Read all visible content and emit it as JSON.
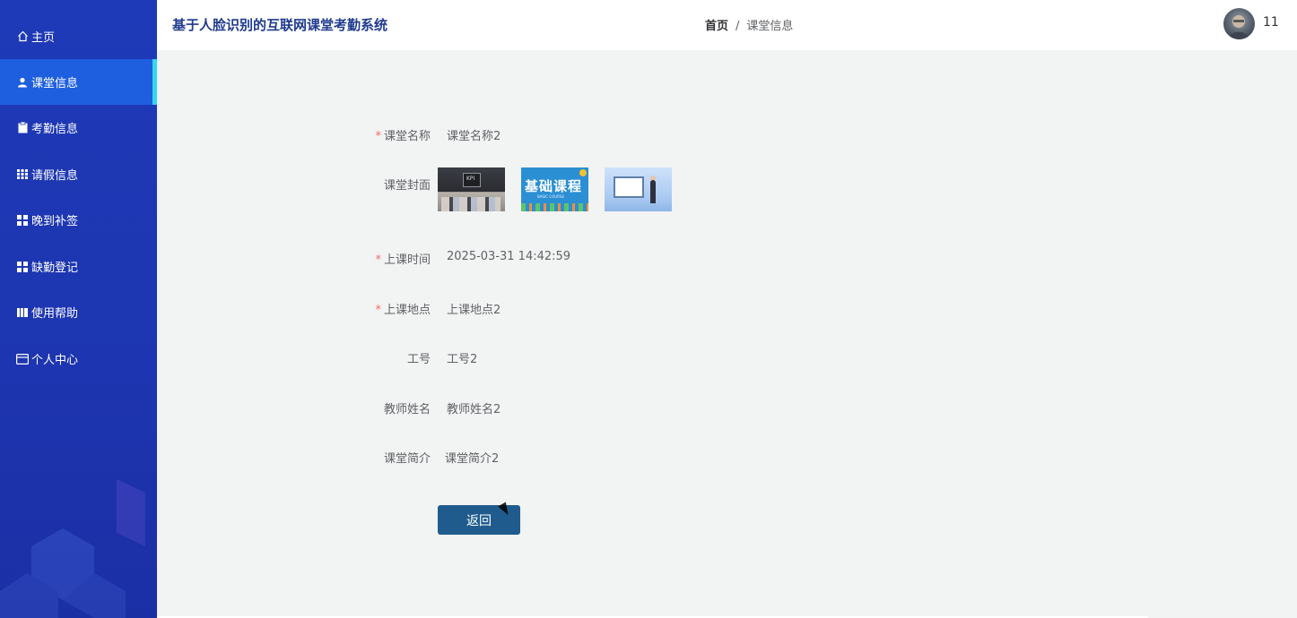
{
  "app": {
    "title": "基于人脸识别的互联网课堂考勤系统"
  },
  "sidebar": {
    "items": [
      {
        "label": "主页",
        "icon": "home-icon",
        "active": false
      },
      {
        "label": "课堂信息",
        "icon": "user-icon",
        "active": true
      },
      {
        "label": "考勤信息",
        "icon": "clipboard-icon",
        "active": false
      },
      {
        "label": "请假信息",
        "icon": "grid-icon",
        "active": false
      },
      {
        "label": "晚到补签",
        "icon": "apps-icon",
        "active": false
      },
      {
        "label": "缺勤登记",
        "icon": "apps-icon",
        "active": false
      },
      {
        "label": "使用帮助",
        "icon": "book-icon",
        "active": false
      },
      {
        "label": "个人中心",
        "icon": "card-icon",
        "active": false
      }
    ],
    "colors": {
      "background": "#1e3ab8",
      "active": "#1e5fe0",
      "active_indicator": "#35d6f5"
    }
  },
  "header": {
    "breadcrumb": {
      "home": "首页",
      "separator": "/",
      "current": "课堂信息"
    },
    "user": {
      "name": "11"
    }
  },
  "form": {
    "course_name": {
      "label": "课堂名称",
      "value": "课堂名称2",
      "required": true
    },
    "cover": {
      "label": "课堂封面",
      "images": [
        {
          "name": "classroom-photo",
          "text": "KPI"
        },
        {
          "name": "basic-course-banner",
          "text": "基础课程",
          "subtext": "BASIC COURSE"
        },
        {
          "name": "lecture-illustration"
        }
      ]
    },
    "class_time": {
      "label": "上课时间",
      "value": "2025-03-31 14:42:59",
      "required": true
    },
    "location": {
      "label": "上课地点",
      "value": "上课地点2",
      "required": true
    },
    "employee_id": {
      "label": "工号",
      "value": "工号2"
    },
    "teacher_name": {
      "label": "教师姓名",
      "value": "教师姓名2"
    },
    "intro": {
      "label": "课堂简介",
      "value": "课堂简介2"
    },
    "back_button": "返回",
    "required_mark": "*"
  },
  "colors": {
    "accent_button": "#1f5c8d",
    "title": "#1f3b8e",
    "required": "#f56c6c"
  }
}
